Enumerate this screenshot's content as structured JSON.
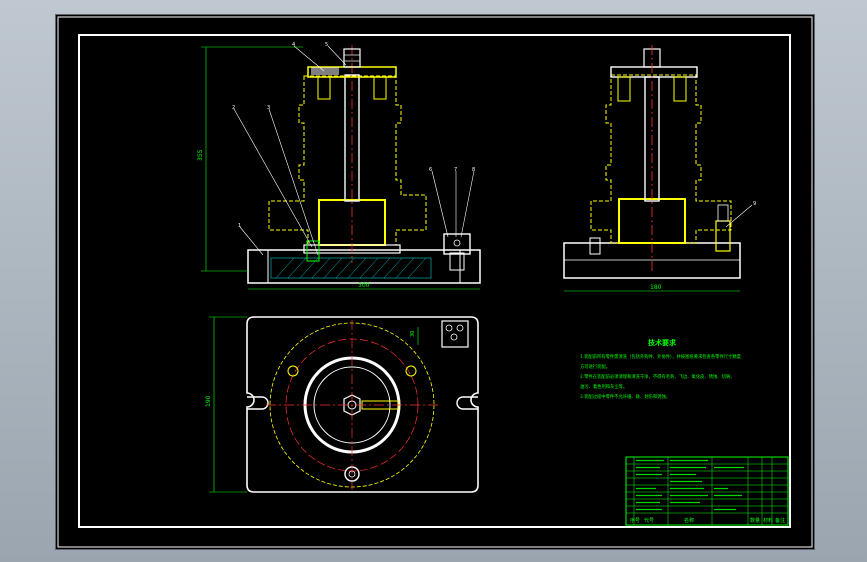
{
  "notes": {
    "title": "技术要求",
    "lines": [
      "1.装配前所有零件需清洗（包括外购件、外协件），并按图纸要求检查各零件尺寸精度",
      "方可进行装配。",
      "2.零件在装配前必须清理和清洗干净，不得有毛刺、飞边、氧化皮、锈蚀、切屑、",
      "油污、着色剂和灰尘等。",
      "3.装配过程中零件不允许磕、碰、划伤和锈蚀。"
    ]
  },
  "balloons": {
    "front": [
      "4",
      "5",
      "2",
      "3",
      "1",
      "6",
      "7",
      "8"
    ],
    "side": [
      "9"
    ]
  },
  "dimensions": {
    "front_height": "355",
    "front_width": "300",
    "side_width": "180",
    "plan_height": "190",
    "plan_offset": "30"
  },
  "title_block": {
    "footer": [
      "序号",
      "代号",
      "名称",
      "数量",
      "材料",
      "备注"
    ]
  },
  "colors": {
    "frame": "#ffffff",
    "part": "#ffff00",
    "centerline": "#ff3030",
    "annotation": "#00ff00",
    "hatch": "#00c8c8"
  }
}
